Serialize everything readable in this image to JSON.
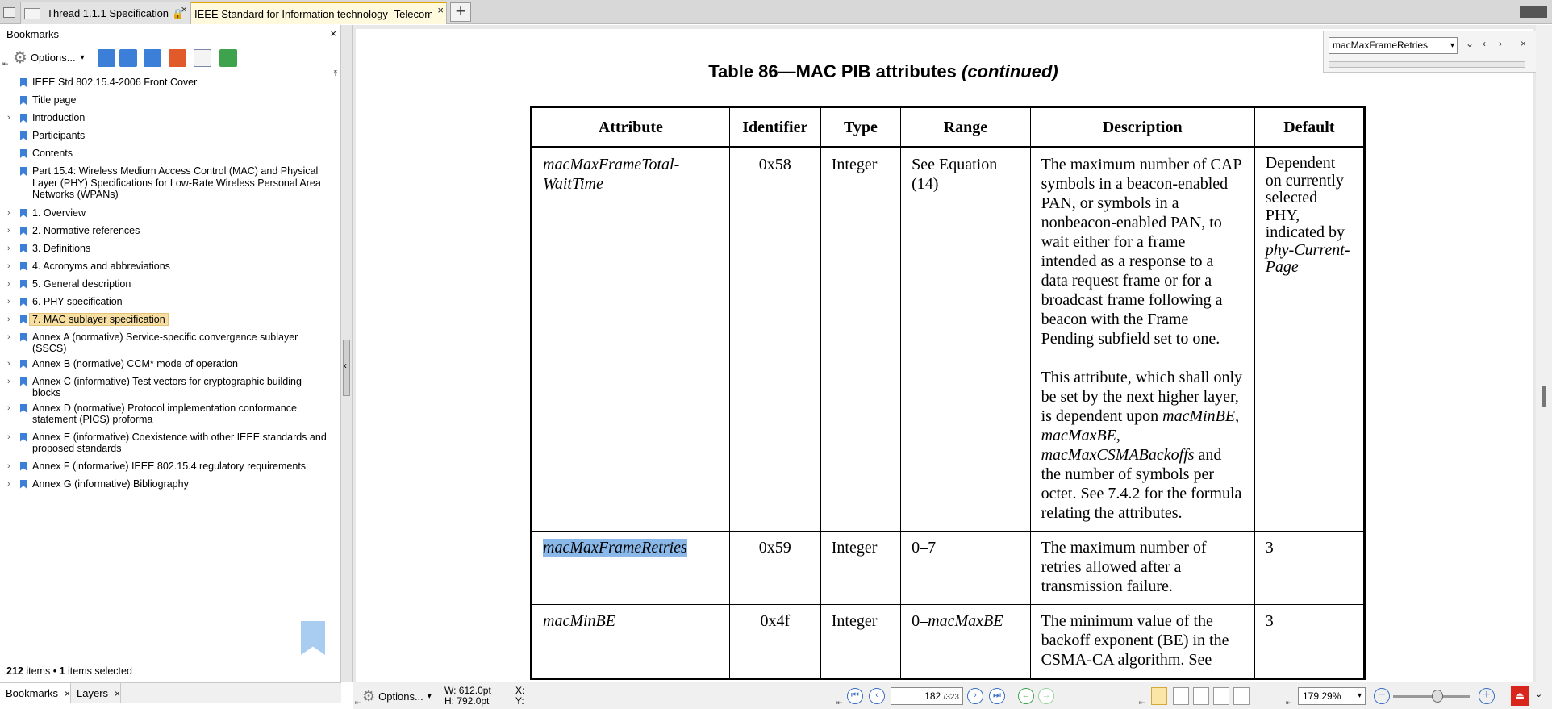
{
  "tabs": [
    {
      "label": "Thread 1.1.1 Specification"
    },
    {
      "label": "IEEE Standard for Information technology- Telecommu..."
    }
  ],
  "bookmarks_panel": {
    "title": "Bookmarks",
    "options_label": "Options...",
    "items": [
      {
        "label": "IEEE Std 802.15.4-2006 Front Cover",
        "expandable": false
      },
      {
        "label": "Title page",
        "expandable": false
      },
      {
        "label": "Introduction",
        "expandable": true
      },
      {
        "label": "Participants",
        "expandable": false
      },
      {
        "label": "Contents",
        "expandable": false
      },
      {
        "label": "Part 15.4: Wireless Medium Access Control (MAC) and Physical Layer (PHY) Specifications for Low-Rate Wireless Personal Area Networks (WPANs)",
        "expandable": false
      },
      {
        "label": "1. Overview",
        "expandable": true
      },
      {
        "label": "2. Normative references",
        "expandable": true
      },
      {
        "label": "3. Definitions",
        "expandable": true
      },
      {
        "label": "4. Acronyms and abbreviations",
        "expandable": true
      },
      {
        "label": "5. General description",
        "expandable": true
      },
      {
        "label": "6. PHY specification",
        "expandable": true
      },
      {
        "label": "7. MAC sublayer specification",
        "expandable": true,
        "selected": true
      },
      {
        "label": "Annex A (normative) Service-specific convergence sublayer (SSCS)",
        "expandable": true
      },
      {
        "label": "Annex B (normative) CCM* mode of operation",
        "expandable": true
      },
      {
        "label": "Annex C (informative) Test vectors for cryptographic building blocks",
        "expandable": true
      },
      {
        "label": "Annex D (normative) Protocol implementation conformance statement (PICS) proforma",
        "expandable": true
      },
      {
        "label": "Annex E (informative) Coexistence with other IEEE standards and proposed standards",
        "expandable": true
      },
      {
        "label": "Annex F (informative) IEEE 802.15.4 regulatory requirements",
        "expandable": true
      },
      {
        "label": "Annex G (informative) Bibliography",
        "expandable": true
      }
    ],
    "status_count": "212",
    "status_items": "items",
    "status_bullet": "•",
    "status_selected_count": "1",
    "status_selected": "items selected",
    "bottom_tabs": [
      "Bookmarks",
      "Layers"
    ]
  },
  "document": {
    "table_title": "Table 86—MAC PIB attributes",
    "table_title_suffix": "(continued)",
    "headers": [
      "Attribute",
      "Identifier",
      "Type",
      "Range",
      "Description",
      "Default"
    ],
    "row1": {
      "attribute": "macMaxFrameTotal-WaitTime",
      "identifier": "0x58",
      "type": "Integer",
      "range": "See Equation (14)",
      "desc_p1": "The maximum number of CAP symbols in a beacon-enabled PAN, or symbols in a nonbeacon-enabled PAN, to wait either for a frame intended as a response to a data request frame or for a broadcast frame following a beacon with the Frame Pending subfield set to one.",
      "desc_p2_a": "This attribute, which shall only be set by the next higher layer, is dependent upon",
      "desc_p2_i1": "macMinBE",
      "desc_p2_i2": "macMaxBE",
      "desc_p2_i3": "macMaxCSMABackoffs",
      "desc_p2_b": "and the number of symbols per octet. See 7.4.2 for the formula relating the attributes.",
      "default_a": "Dependent on currently selected PHY, indicated by",
      "default_i": "phy-Current-Page"
    },
    "row2": {
      "attribute": "macMaxFrameRetries",
      "identifier": "0x59",
      "type": "Integer",
      "range": "0–7",
      "description": "The maximum number of retries allowed after a transmission failure.",
      "default": "3"
    },
    "row3": {
      "attribute": "macMinBE",
      "identifier": "0x4f",
      "type": "Integer",
      "range_a": "0–",
      "range_i": "macMaxBE",
      "description": "The minimum value of the backoff exponent (BE) in the CSMA-CA algorithm. See",
      "default": "3"
    }
  },
  "find": {
    "value": "macMaxFrameRetries"
  },
  "statusbar": {
    "options_label": "Options...",
    "width": "W: 612.0pt",
    "height": "H: 792.0pt",
    "x_label": "X:",
    "y_label": "Y:",
    "current_page": "182",
    "total_pages": "323",
    "zoom": "179.29%"
  },
  "colors": {
    "highlight": "#8ab8e8",
    "selected_bookmark": "#f7dfa2",
    "active_tab_accent": "#e2a400"
  }
}
